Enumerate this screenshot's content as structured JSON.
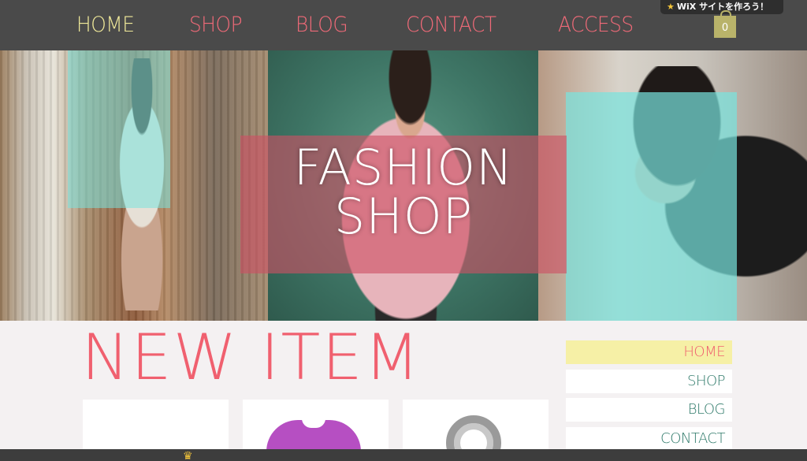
{
  "nav": {
    "items": [
      "HOME",
      "SHOP",
      "BLOG",
      "CONTACT",
      "ACCESS"
    ]
  },
  "wix_badge": {
    "brand": "WiX",
    "text": "サイトを作ろう！"
  },
  "cart": {
    "count": "0",
    "icon": "shopping-bag-icon"
  },
  "hero": {
    "title_line1": "FASHION",
    "title_line2": "SHOP"
  },
  "content": {
    "heading": "NEW ITEM"
  },
  "products": [
    {
      "name": "product-1"
    },
    {
      "name": "product-purple-shirt"
    },
    {
      "name": "product-gray-scarf"
    }
  ],
  "side_menu": {
    "items": [
      "HOME",
      "SHOP",
      "BLOG",
      "CONTACT"
    ]
  },
  "colors": {
    "topbar": "#4a4a4a",
    "accent_pink": "#f0606f",
    "accent_yellow": "#f1ea9a",
    "cyan_overlay": "#78e4de",
    "side_text": "#2f7a6a"
  }
}
